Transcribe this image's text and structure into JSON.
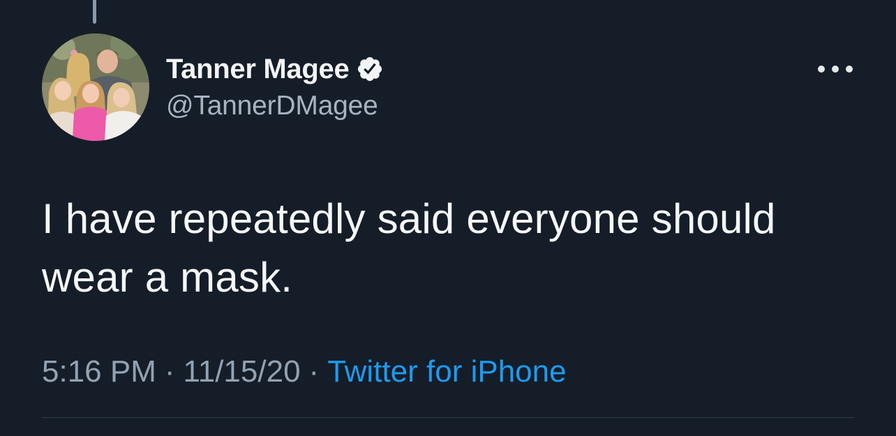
{
  "tweet": {
    "author": {
      "display_name": "Tanner Magee",
      "handle": "@TannerDMagee",
      "verified": true
    },
    "text": "I have repeatedly said everyone should\nwear a mask.",
    "meta": {
      "time": "5:16 PM",
      "date": "11/15/20",
      "separator": "·",
      "source": "Twitter for iPhone"
    }
  },
  "icons": {
    "verified": "verified-badge-icon",
    "more": "more-options-icon"
  },
  "colors": {
    "background": "#151d28",
    "link": "#1d9bf0",
    "secondary_text": "#93a2b2"
  }
}
